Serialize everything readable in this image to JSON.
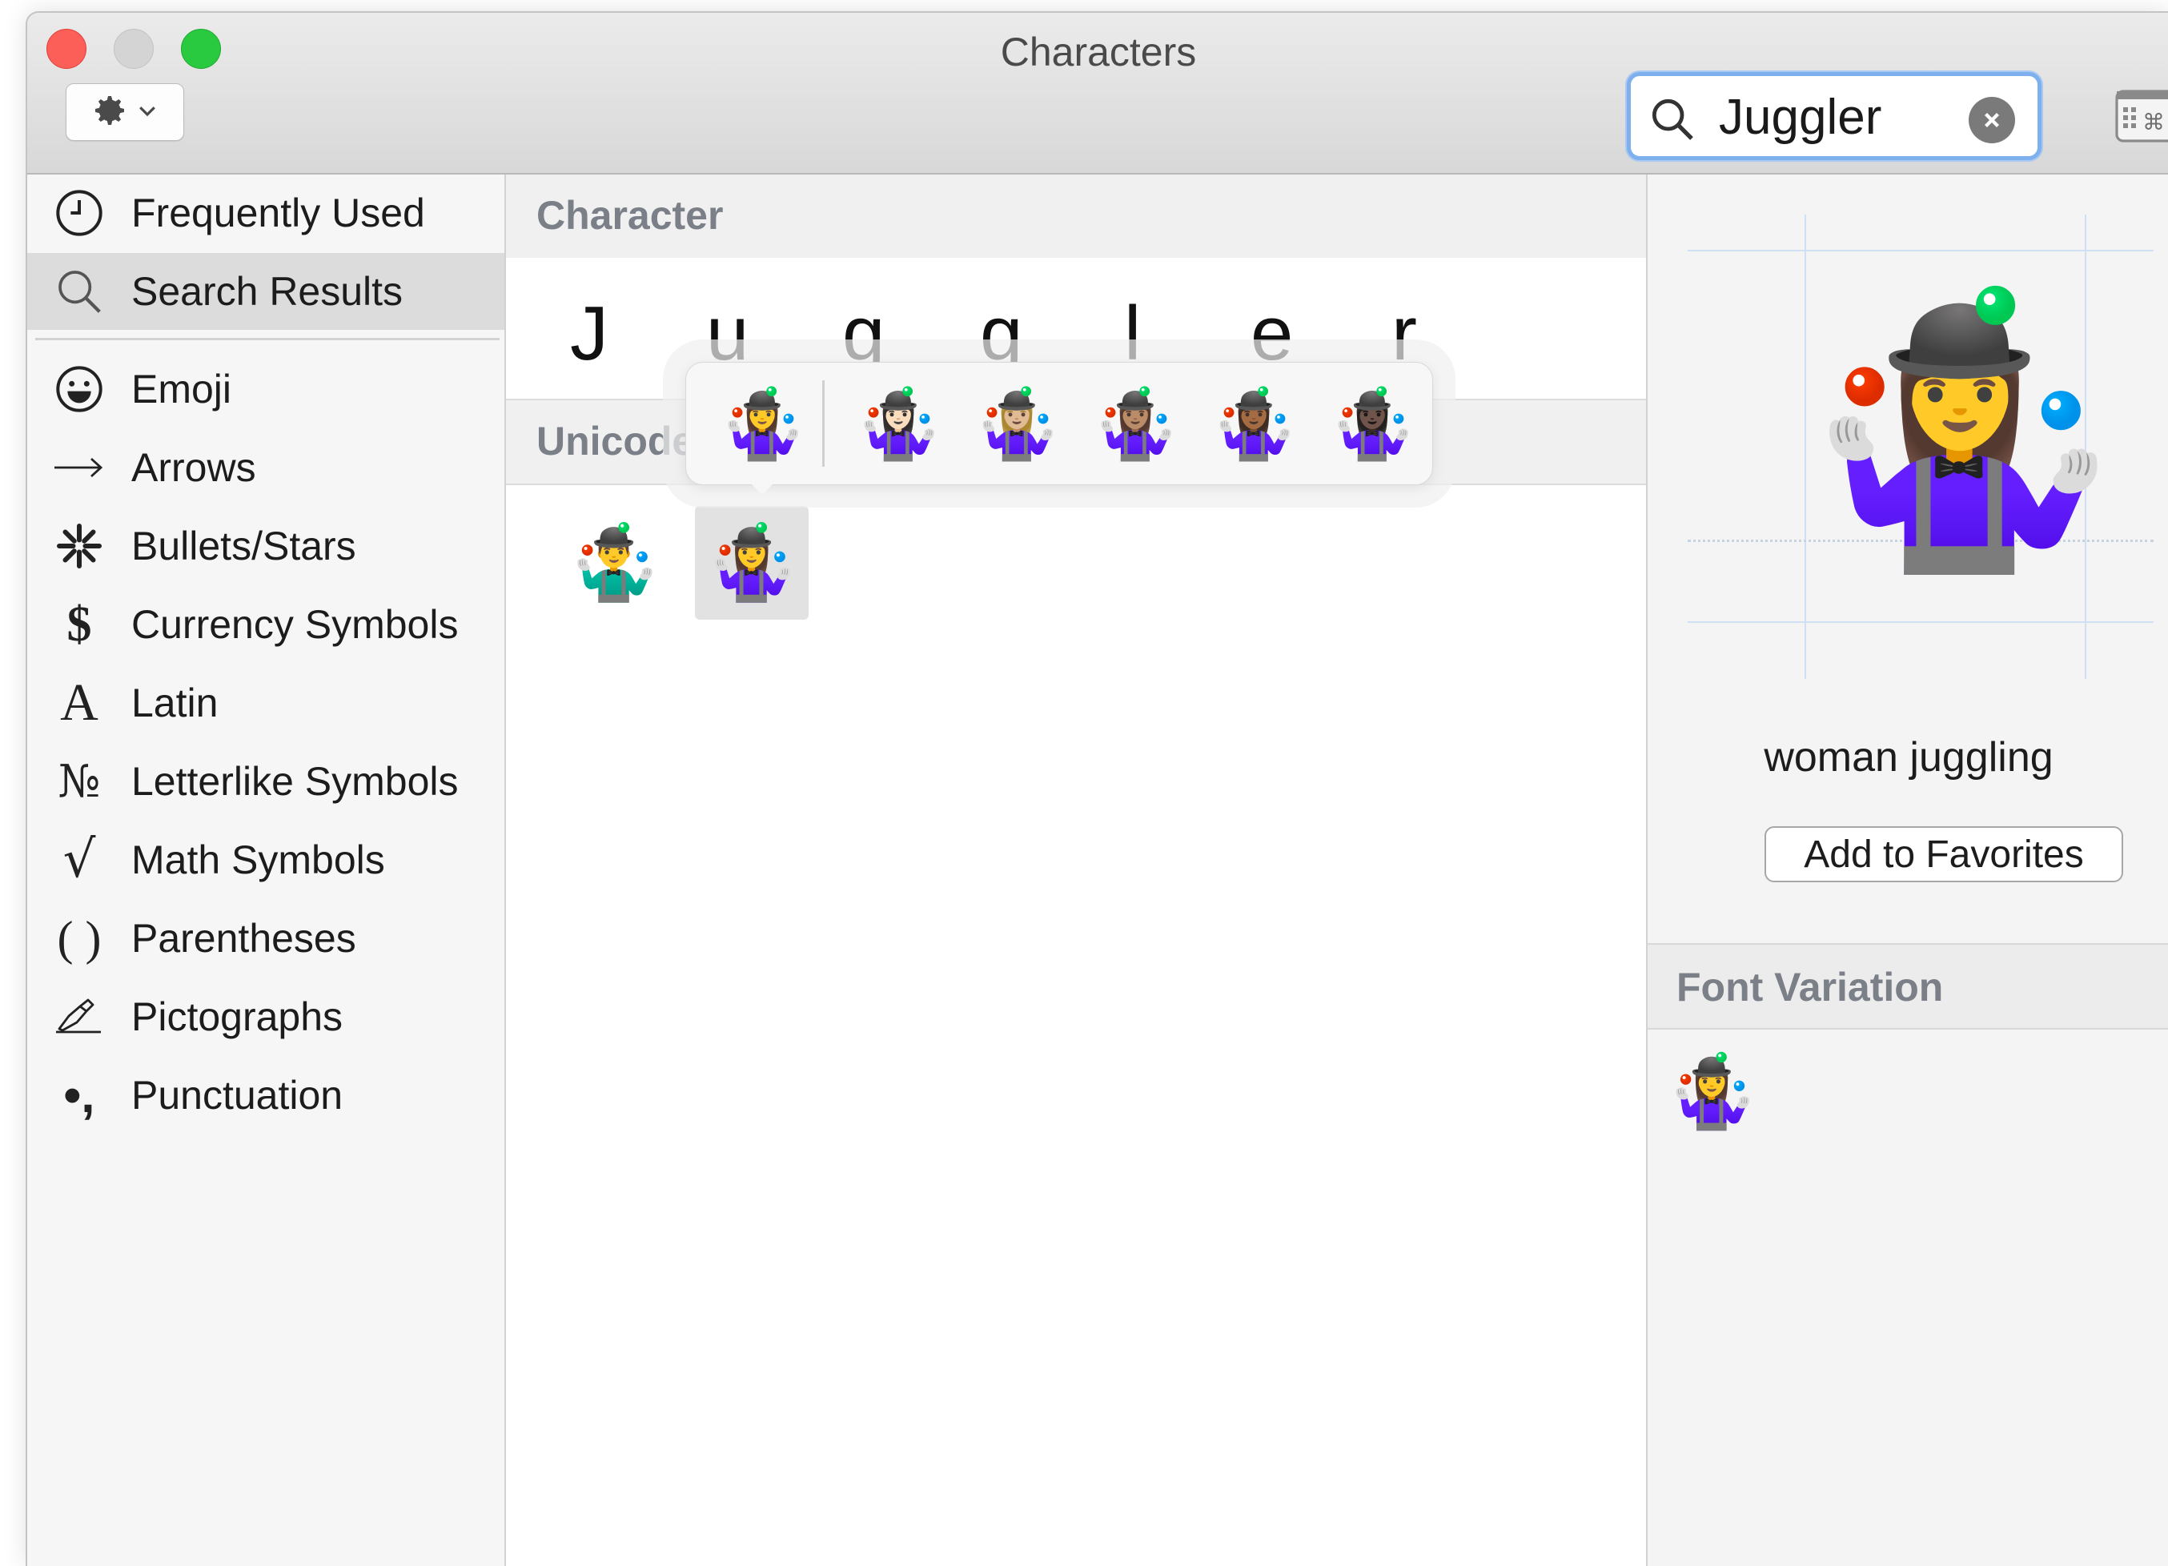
{
  "window": {
    "title": "Characters"
  },
  "toolbar": {
    "action_icon": "gear-icon",
    "search_value": "Juggler",
    "clear_icon": "clear-icon",
    "keyboard_viewer_icon": "keyboard-viewer-icon"
  },
  "sidebar": {
    "items": [
      {
        "label": "Frequently Used",
        "icon": "clock-icon"
      },
      {
        "label": "Search Results",
        "icon": "search-icon",
        "selected": true
      },
      {
        "label": "Emoji",
        "icon": "smiley-icon"
      },
      {
        "label": "Arrows",
        "icon": "arrow-icon"
      },
      {
        "label": "Bullets/Stars",
        "icon": "asterisk-icon"
      },
      {
        "label": "Currency Symbols",
        "icon": "dollar-icon"
      },
      {
        "label": "Latin",
        "icon": "latin-a-icon"
      },
      {
        "label": "Letterlike Symbols",
        "icon": "numero-icon"
      },
      {
        "label": "Math Symbols",
        "icon": "sqrt-icon"
      },
      {
        "label": "Parentheses",
        "icon": "parentheses-icon"
      },
      {
        "label": "Pictographs",
        "icon": "writing-hand-icon"
      },
      {
        "label": "Punctuation",
        "icon": "punctuation-icon"
      }
    ]
  },
  "center": {
    "character_header": "Character",
    "characters": [
      "J",
      "u",
      "g",
      "g",
      "l",
      "e",
      "r"
    ],
    "unicode_header": "Unicode",
    "results": [
      "🤹‍♂️",
      "🤹‍♀️"
    ],
    "selected_result": 1,
    "skin_tone_variants": [
      "🤹‍♀️",
      "🤹🏻‍♀️",
      "🤹🏼‍♀️",
      "🤹🏽‍♀️",
      "🤹🏾‍♀️",
      "🤹🏿‍♀️"
    ]
  },
  "detail": {
    "preview_glyph": "🤹‍♀️",
    "name": "woman juggling",
    "favorites_button": "Add to Favorites",
    "font_variation_header": "Font Variation",
    "font_variations": [
      "🤹‍♀️"
    ]
  },
  "colors": {
    "search_focus": "#7fb0ee",
    "section_header_text": "#7a7f88",
    "selected_row": "#dcdcdc"
  }
}
